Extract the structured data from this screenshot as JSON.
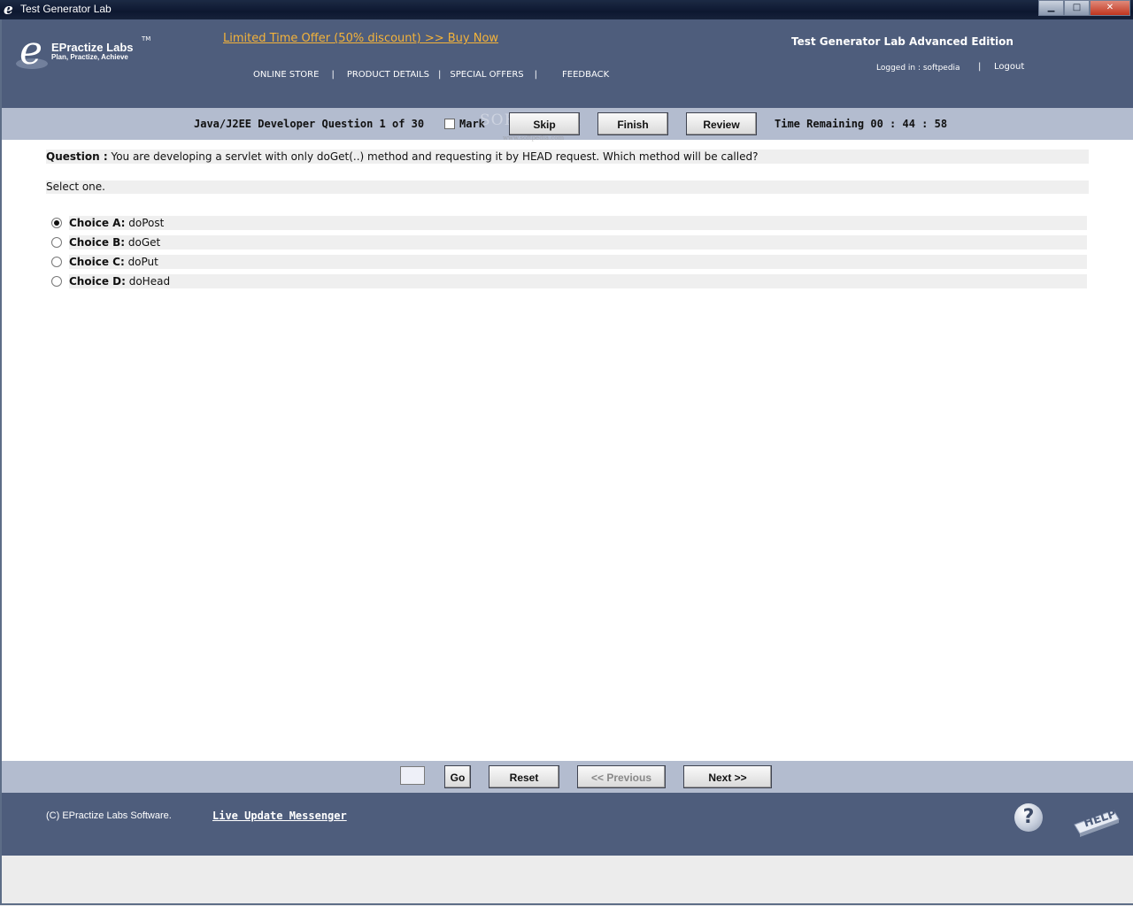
{
  "window": {
    "title": "Test Generator Lab",
    "controls": {
      "minimize": "▁",
      "maximize": "□",
      "close": "✕"
    }
  },
  "header": {
    "logo_name": "EPractize Labs",
    "logo_tm": "TM",
    "logo_tagline": "Plan, Practize, Achieve",
    "offer_link": "Limited Time Offer (50% discount) >> Buy Now",
    "nav": [
      "ONLINE STORE",
      "PRODUCT DETAILS",
      "SPECIAL OFFERS",
      "FEEDBACK"
    ],
    "nav_separator": "|",
    "edition": "Test Generator Lab Advanced Edition",
    "logged_in": "Logged in : softpedia",
    "logout": "Logout"
  },
  "question_bar": {
    "counter": "Java/J2EE Developer Question 1 of 30",
    "mark_label": "Mark",
    "mark_checked": false,
    "skip": "Skip",
    "finish": "Finish",
    "review": "Review",
    "time_remaining": "Time Remaining 00 : 44 : 58",
    "watermark": "SOFTPEDIA",
    "watermark_sub": "www.softpedia.com"
  },
  "question": {
    "label": "Question :",
    "text": " You are developing a servlet with only doGet(..) method and requesting it by HEAD request. Which method will be called?",
    "instruction": "Select one."
  },
  "choices": [
    {
      "label": "Choice A:",
      "text": " doPost",
      "selected": true
    },
    {
      "label": "Choice B:",
      "text": " doGet",
      "selected": false
    },
    {
      "label": "Choice C:",
      "text": " doPut",
      "selected": false
    },
    {
      "label": "Choice D:",
      "text": " doHead",
      "selected": false
    }
  ],
  "navigation": {
    "goto_value": "",
    "go": "Go",
    "reset": "Reset",
    "previous": "<< Previous",
    "next": "Next >>"
  },
  "footer": {
    "copyright": "(C) EPractize Labs Software.",
    "live_update": "Live Update Messenger",
    "question_icon": "?",
    "help_icon_text": "HELP"
  },
  "colors": {
    "header_bg": "#4e5d7c",
    "bar_bg": "#b3bccf",
    "offer_link": "#f4b33a"
  }
}
